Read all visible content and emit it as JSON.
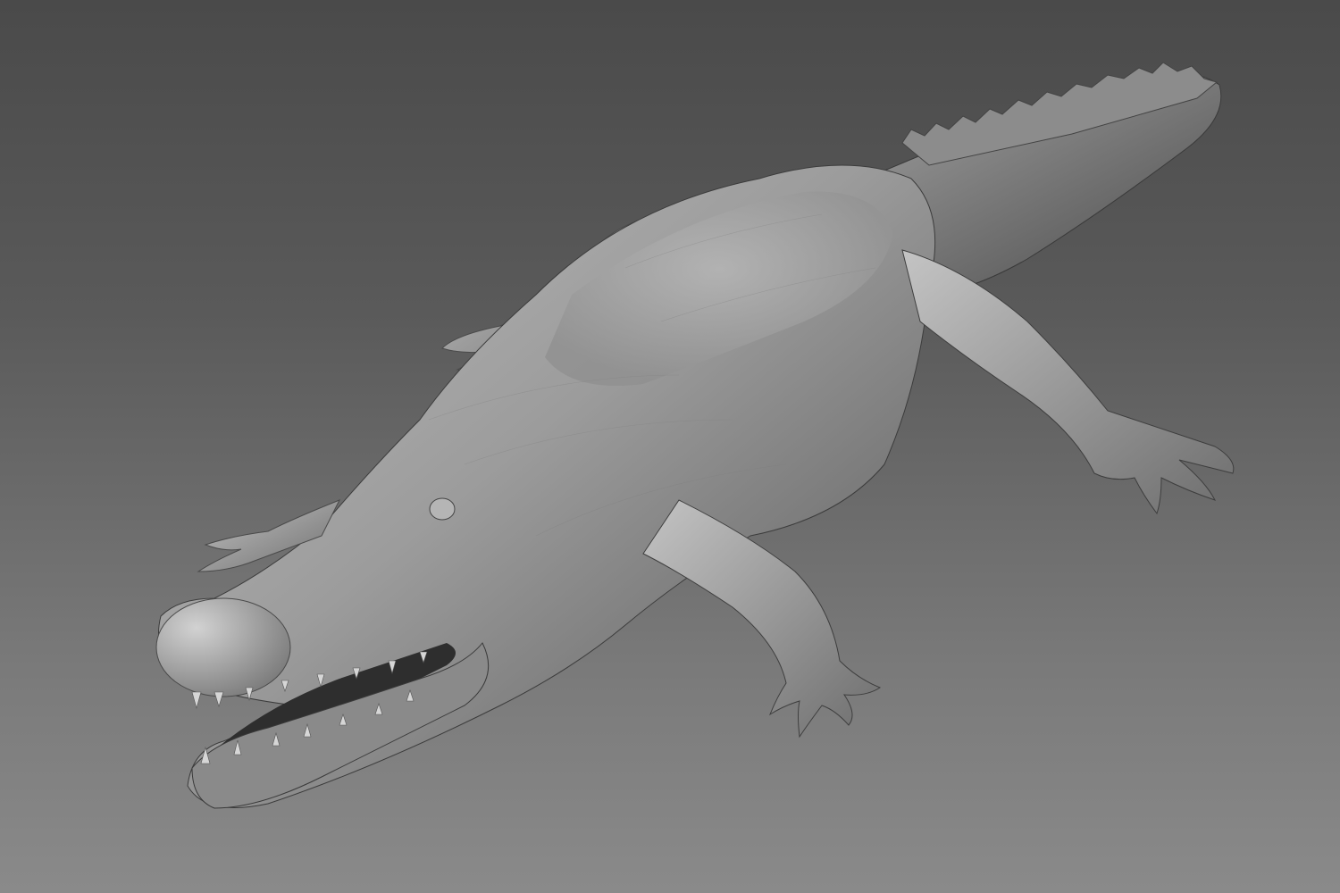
{
  "viewport": {
    "background_top": "#4a4a4a",
    "background_bottom": "#8a8a8a"
  },
  "model": {
    "subject": "crocodile",
    "material_color": "#9a9a9a",
    "material_highlight": "#d8d8d8",
    "material_shadow": "#3c3c3c"
  }
}
